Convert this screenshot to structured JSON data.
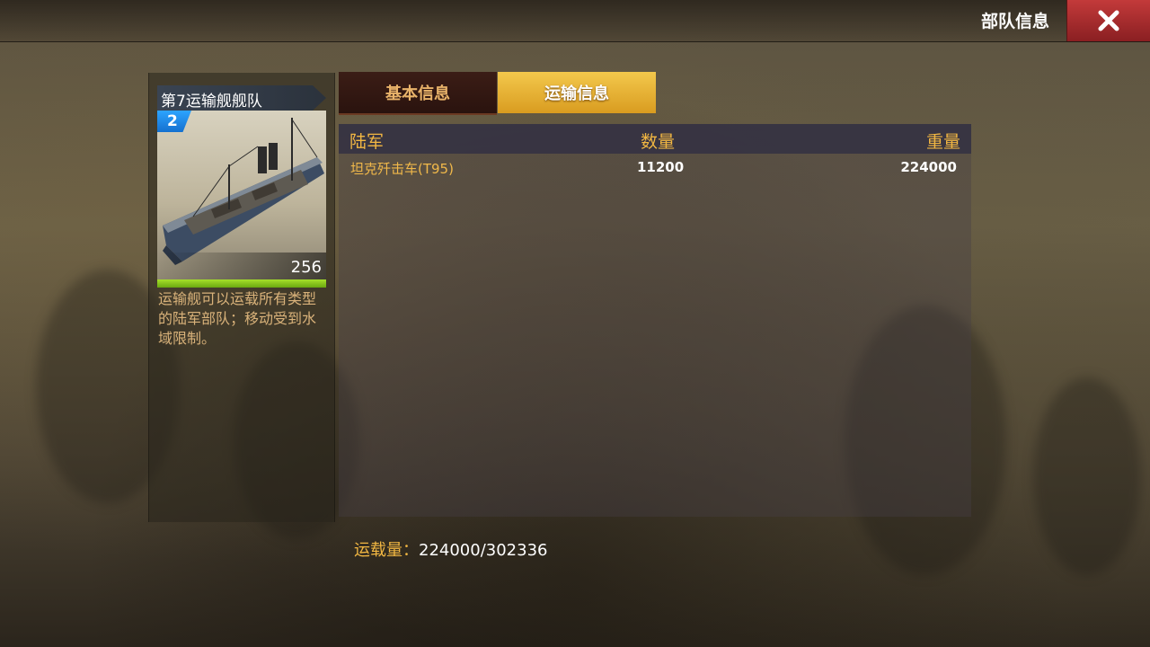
{
  "header": {
    "title": "部队信息",
    "close_icon": "close-icon"
  },
  "unit": {
    "name": "第7运输舰舰队",
    "level": "2",
    "count": "256",
    "description": "运输舰可以运载所有类型的陆军部队；移动受到水域限制。",
    "health_fraction": 1.0,
    "image_icon": "transport-ship-image"
  },
  "tabs": [
    {
      "label": "基本信息",
      "active": false
    },
    {
      "label": "运输信息",
      "active": true
    }
  ],
  "table": {
    "headers": {
      "army": "陆军",
      "quantity": "数量",
      "weight": "重量"
    },
    "rows": [
      {
        "name": "坦克歼击车(T95)",
        "quantity": "11200",
        "weight": "224000"
      }
    ]
  },
  "capacity": {
    "label": "运载量：",
    "value": "224000/302336"
  },
  "colors": {
    "accent_gold": "#f2b742",
    "active_tab": "#e8b43a",
    "close_red": "#b32f31",
    "health_green": "#8fd020",
    "level_blue": "#1f8ef0"
  }
}
